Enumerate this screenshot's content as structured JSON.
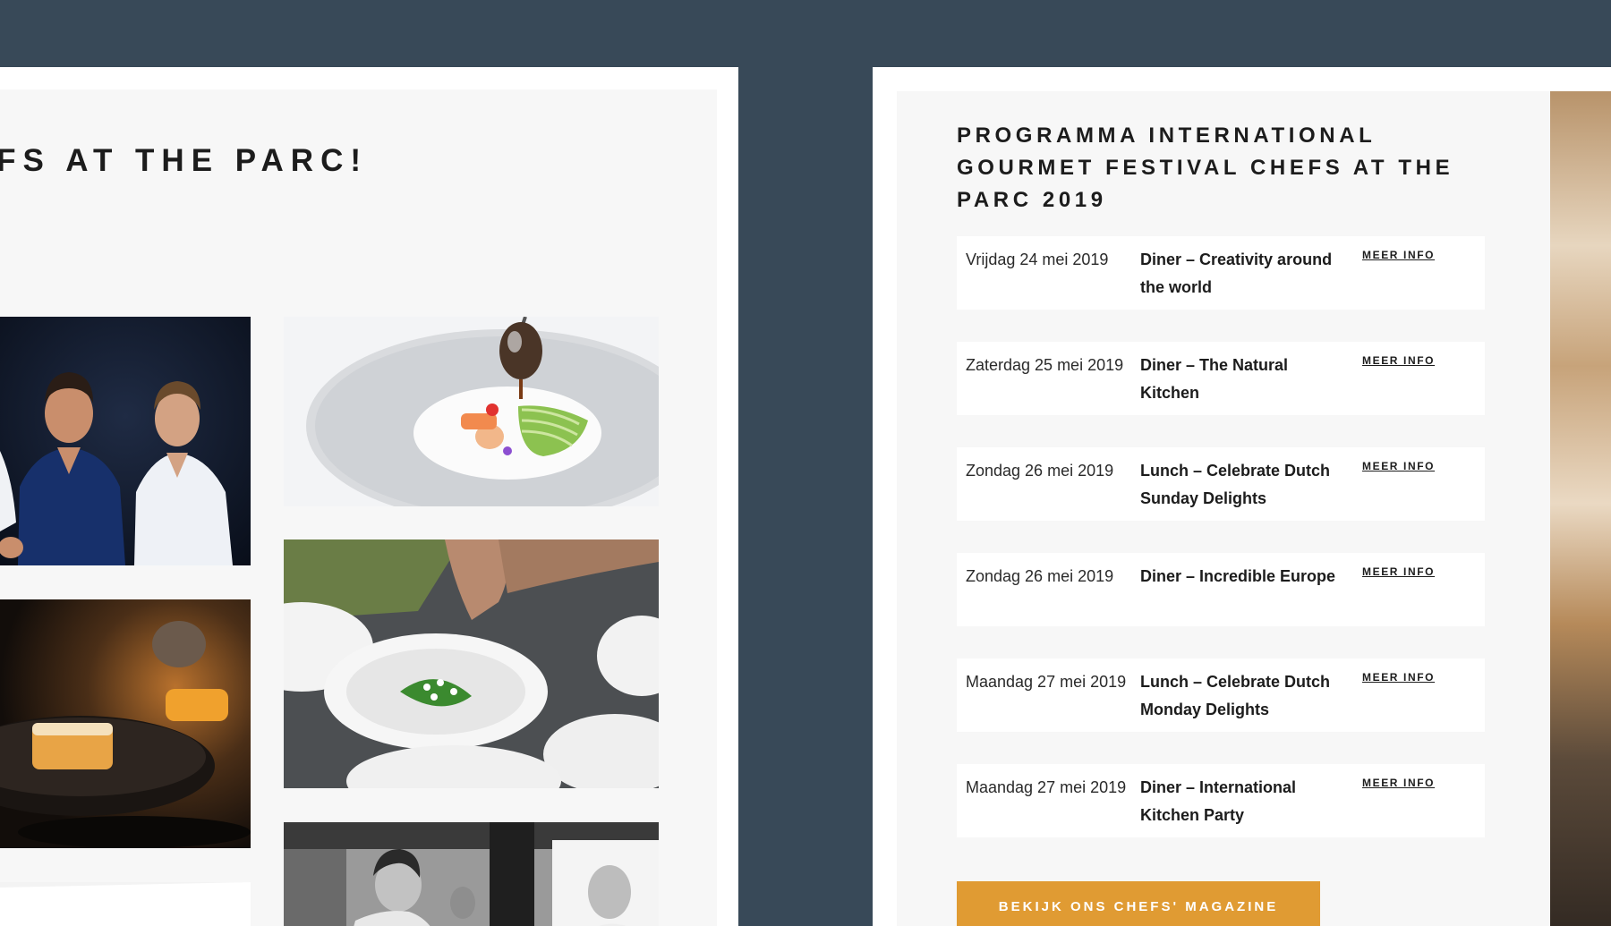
{
  "left": {
    "title": "EFS AT THE PARC!"
  },
  "program": {
    "title": "PROGRAMMA INTERNATIONAL GOURMET FESTIVAL CHEFS AT THE PARC 2019",
    "events": [
      {
        "date": "Vrijdag 24 mei 2019",
        "title": "Diner – Creativity around the world",
        "link": "MEER INFO"
      },
      {
        "date": "Zaterdag 25 mei 2019",
        "title": "Diner – The Natural Kitchen",
        "link": "MEER INFO"
      },
      {
        "date": "Zondag 26 mei 2019",
        "title": "Lunch – Celebrate Dutch Sunday Delights",
        "link": "MEER INFO"
      },
      {
        "date": "Zondag 26 mei 2019",
        "title": "Diner – Incredible Europe",
        "link": "MEER INFO"
      },
      {
        "date": "Maandag 27 mei 2019",
        "title": "Lunch – Celebrate Dutch Monday Delights",
        "link": "MEER INFO"
      },
      {
        "date": "Maandag 27 mei 2019",
        "title": "Diner – International Kitchen Party",
        "link": "MEER INFO"
      }
    ],
    "button": "BEKIJK ONS CHEFS' MAGAZINE"
  },
  "colors": {
    "background": "#384958",
    "accent": "#e09b33",
    "panel": "#f7f7f7"
  },
  "icons": {
    "back_to_top": "chevron-up-icon"
  }
}
